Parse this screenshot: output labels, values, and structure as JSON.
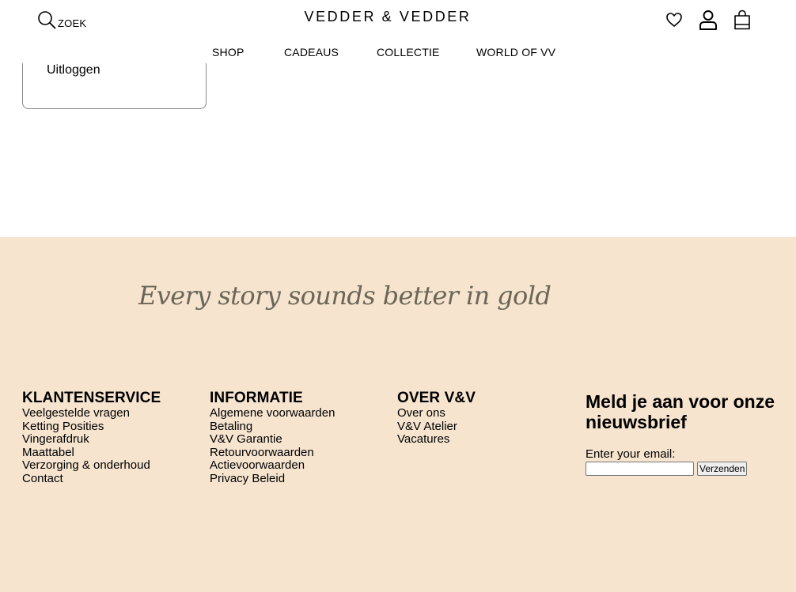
{
  "account_menu": {
    "logout_label": "Uitloggen"
  },
  "header": {
    "search_label": "ZOEK",
    "brand": "VEDDER & VEDDER",
    "nav": [
      "SHOP",
      "CADEAUS",
      "COLLECTIE",
      "WORLD OF VV"
    ],
    "icons": [
      "search-icon",
      "heart-icon",
      "user-icon",
      "shopping-bag-icon"
    ]
  },
  "footer": {
    "background_color": "#f6e4cf",
    "tagline": "Every story sounds better in gold",
    "columns": [
      {
        "title": "KLANTENSERVICE",
        "links": [
          "Veelgestelde vragen",
          "Ketting Posities",
          "Vingerafdruk",
          "Maattabel",
          "Verzorging & onderhoud",
          "Contact"
        ]
      },
      {
        "title": "INFORMATIE",
        "links": [
          "Algemene voorwaarden",
          "Betaling",
          "V&V Garantie",
          "Retourvoorwaarden",
          "Actievoorwaarden",
          "Privacy Beleid"
        ]
      },
      {
        "title": "OVER V&V",
        "links": [
          "Over ons",
          "V&V Atelier",
          "Vacatures"
        ]
      }
    ],
    "newsletter": {
      "title": "Meld je aan voor onze nieuwsbrief",
      "email_label": "Enter your email:",
      "email_value": "",
      "submit_label": "Verzenden"
    }
  }
}
